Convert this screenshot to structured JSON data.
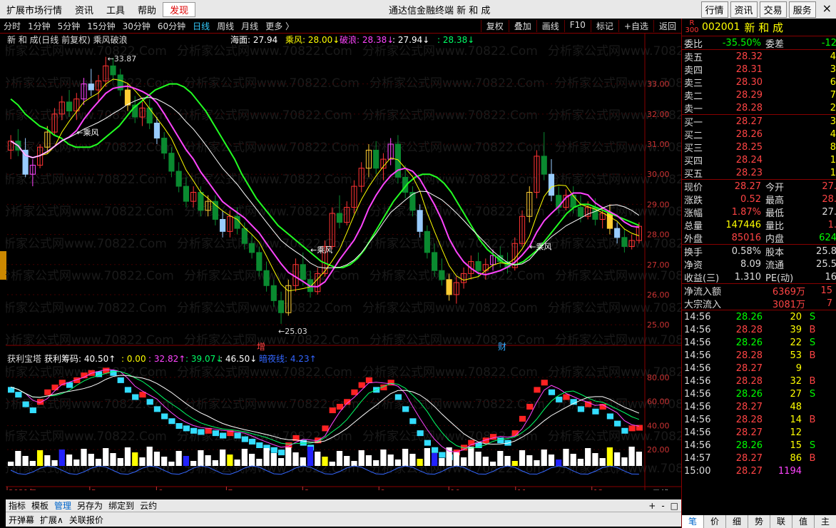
{
  "topbar": {
    "menus": [
      "扩展市场行情",
      "资讯",
      "工具",
      "帮助",
      "发现"
    ],
    "title": "通达信金融终端  新 和 成",
    "right_buttons": [
      "行情",
      "资讯",
      "交易",
      "服务"
    ],
    "close": "×"
  },
  "period": {
    "items": [
      "分时",
      "1分钟",
      "5分钟",
      "15分钟",
      "30分钟",
      "60分钟",
      "日线",
      "周线",
      "月线",
      "更多 〉"
    ],
    "selected": "日线",
    "tools": [
      "复权",
      "叠加",
      "画线",
      "F10",
      "标记",
      "+自选",
      "返回"
    ]
  },
  "main_chart": {
    "title": "新 和 成(日线 前复权) 乘风破浪",
    "legend": [
      {
        "label": "海面: 27.94",
        "color": "#ffffff"
      },
      {
        "label": "乘风: 28.00↓",
        "color": "#ffff00"
      },
      {
        "label": "破浪: 28.38↓",
        "color": "#ff44ff"
      },
      {
        "label": ": 27.94↓",
        "color": "#ffffff"
      },
      {
        "label": ": 28.38↓",
        "color": "#00ff66"
      }
    ],
    "y_ticks": [
      "33.00",
      "32.00",
      "31.00",
      "30.00",
      "29.00",
      "28.00",
      "27.00",
      "26.00",
      "25.00"
    ],
    "high_label": "33.87",
    "low_label": "25.03",
    "signal_label": "乘风",
    "markers": [
      "增",
      "财"
    ]
  },
  "sub_chart": {
    "title": "获利宝塔",
    "legend": [
      {
        "label": "获利筹码: 40.50↑",
        "color": "#ffffff"
      },
      {
        "label": ": 0.00",
        "color": "#ffff00"
      },
      {
        "label": ": 32.82↑",
        "color": "#ff44ff"
      },
      {
        "label": ": 39.07↓",
        "color": "#00ff66"
      },
      {
        "label": ": 46.50↓",
        "color": "#ffffff"
      },
      {
        "label": "暗夜线: 4.23↑",
        "color": "#3366ff"
      }
    ],
    "y_ticks": [
      "80.00",
      "60.00",
      "40.00",
      "20.00"
    ]
  },
  "x_axis": {
    "labels": [
      "2021年",
      "5",
      "6",
      "7",
      "8",
      "9",
      "10",
      "11",
      "12"
    ],
    "period_label": "日线"
  },
  "watermark": "分析家公式网www.70822.Com",
  "bottom_tabs1": [
    "指标",
    "模板",
    "管理",
    "另存为",
    "绑定到",
    "云约"
  ],
  "bottom_tabs1_selected": "管理",
  "bottom_tabs2": [
    "开弹幕",
    "扩展∧",
    "关联报价"
  ],
  "nav_buttons": [
    "+",
    "-",
    "□"
  ],
  "quote": {
    "board": "R",
    "board2": "300",
    "code": "002001",
    "name": "新 和 成",
    "weibi_label": "委比",
    "weibi": "-35.50%",
    "weicha_label": "委差",
    "weicha": "-12",
    "asks": [
      {
        "label": "卖五",
        "price": "28.32",
        "qty": "4"
      },
      {
        "label": "卖四",
        "price": "28.31",
        "qty": "3"
      },
      {
        "label": "卖三",
        "price": "28.30",
        "qty": "6"
      },
      {
        "label": "卖二",
        "price": "28.29",
        "qty": "7"
      },
      {
        "label": "卖一",
        "price": "28.28",
        "qty": "2"
      }
    ],
    "bids": [
      {
        "label": "买一",
        "price": "28.27",
        "qty": "3"
      },
      {
        "label": "买二",
        "price": "28.26",
        "qty": "4"
      },
      {
        "label": "买三",
        "price": "28.25",
        "qty": "8"
      },
      {
        "label": "买四",
        "price": "28.24",
        "qty": "1"
      },
      {
        "label": "买五",
        "price": "28.23",
        "qty": "1"
      }
    ],
    "stats": [
      {
        "k1": "现价",
        "v1": "28.27",
        "c1": "#f44",
        "k2": "今开",
        "v2": "27.",
        "c2": "#f44"
      },
      {
        "k1": "涨跌",
        "v1": "0.52",
        "c1": "#f44",
        "k2": "最高",
        "v2": "28.",
        "c2": "#f44"
      },
      {
        "k1": "涨幅",
        "v1": "1.87%",
        "c1": "#f44",
        "k2": "最低",
        "v2": "27.",
        "c2": "#ddd"
      },
      {
        "k1": "总量",
        "v1": "147446",
        "c1": "#ff0",
        "k2": "量比",
        "v2": "1.",
        "c2": "#f44"
      },
      {
        "k1": "外盘",
        "v1": "85016",
        "c1": "#f44",
        "k2": "内盘",
        "v2": "624",
        "c2": "#0f0"
      }
    ],
    "stats2": [
      {
        "k1": "换手",
        "v1": "0.58%",
        "k2": "股本",
        "v2": "25.8"
      },
      {
        "k1": "净资",
        "v1": "8.09",
        "k2": "流通",
        "v2": "25.5"
      },
      {
        "k1": "收益(三)",
        "v1": "1.310",
        "k2": "PE(动)",
        "v2": "16"
      }
    ],
    "flow": [
      {
        "k": "净流入额",
        "v": "6369万",
        "v2": "15"
      },
      {
        "k": "大宗流入",
        "v": "3081万",
        "v2": "7"
      }
    ],
    "ticks": [
      {
        "t": "14:56",
        "p": "28.26",
        "v": "20",
        "bs": "S"
      },
      {
        "t": "14:56",
        "p": "28.28",
        "v": "39",
        "bs": "B"
      },
      {
        "t": "14:56",
        "p": "28.26",
        "v": "22",
        "bs": "S"
      },
      {
        "t": "14:56",
        "p": "28.28",
        "v": "53",
        "bs": "B"
      },
      {
        "t": "14:56",
        "p": "28.27",
        "v": "9",
        "bs": ""
      },
      {
        "t": "14:56",
        "p": "28.28",
        "v": "32",
        "bs": "B"
      },
      {
        "t": "14:56",
        "p": "28.26",
        "v": "27",
        "bs": "S"
      },
      {
        "t": "14:56",
        "p": "28.27",
        "v": "48",
        "bs": ""
      },
      {
        "t": "14:56",
        "p": "28.28",
        "v": "14",
        "bs": "B"
      },
      {
        "t": "14:56",
        "p": "28.27",
        "v": "12",
        "bs": ""
      },
      {
        "t": "14:56",
        "p": "28.26",
        "v": "15",
        "bs": "S"
      },
      {
        "t": "14:57",
        "p": "28.27",
        "v": "86",
        "bs": "B"
      },
      {
        "t": "15:00",
        "p": "28.27",
        "v": "1194",
        "bs": ""
      }
    ],
    "side_tabs": [
      "笔",
      "价",
      "细",
      "势",
      "联",
      "值",
      "主"
    ]
  },
  "chart_data": {
    "type": "candlestick",
    "title": "新 和 成(日线 前复权) 乘风破浪",
    "ylim": [
      24.6,
      34.2
    ],
    "ma_green": [
      32.5,
      32.3,
      32.0,
      31.8,
      31.6,
      31.5,
      31.3,
      31.2,
      31.0,
      30.9,
      30.9,
      30.9,
      31.0,
      31.2,
      31.4,
      31.6,
      31.9,
      32.2,
      32.4,
      32.6,
      32.8,
      32.9,
      33.0,
      33.0,
      32.9,
      32.7,
      32.4,
      32.1,
      31.7,
      31.3,
      30.9,
      30.5,
      30.0,
      29.6,
      29.2,
      28.9,
      28.6,
      28.3,
      28.1,
      27.9,
      27.7,
      27.5,
      27.3,
      27.1,
      27.0,
      26.9,
      26.9,
      27.0,
      27.2,
      27.5,
      27.9,
      28.3,
      28.7,
      29.1,
      29.4,
      29.7,
      29.9,
      30.0,
      30.0,
      29.9,
      29.7,
      29.4,
      29.0,
      28.6,
      28.2,
      27.8,
      27.5,
      27.3,
      27.1,
      27.0,
      27.0,
      27.1,
      27.3,
      27.5,
      27.8,
      28.1,
      28.4,
      28.7,
      28.9,
      29.0,
      29.0,
      28.9,
      28.8,
      28.7,
      28.6,
      28.5,
      28.4,
      28.3
    ],
    "candles": [
      [
        30.8,
        31.3,
        30.5,
        31.1
      ],
      [
        31.1,
        31.5,
        30.6,
        30.8
      ],
      [
        30.8,
        31.2,
        29.9,
        30.0
      ],
      [
        30.0,
        30.5,
        29.6,
        30.3
      ],
      [
        30.3,
        31.0,
        30.2,
        30.9
      ],
      [
        30.9,
        31.6,
        30.7,
        31.4
      ],
      [
        31.4,
        32.2,
        31.3,
        32.0
      ],
      [
        32.0,
        32.6,
        31.8,
        32.4
      ],
      [
        32.4,
        32.8,
        31.9,
        32.1
      ],
      [
        32.1,
        32.7,
        31.8,
        32.5
      ],
      [
        32.5,
        33.2,
        32.3,
        33.0
      ],
      [
        33.0,
        33.5,
        32.6,
        32.8
      ],
      [
        32.8,
        33.3,
        32.4,
        33.1
      ],
      [
        33.1,
        33.9,
        32.9,
        33.6
      ],
      [
        33.6,
        33.87,
        33.1,
        33.3
      ],
      [
        33.3,
        33.5,
        32.6,
        32.8
      ],
      [
        32.8,
        33.0,
        32.1,
        32.3
      ],
      [
        32.3,
        32.6,
        31.7,
        31.9
      ],
      [
        31.9,
        32.4,
        31.6,
        32.2
      ],
      [
        32.2,
        32.5,
        31.5,
        31.7
      ],
      [
        31.7,
        31.9,
        31.0,
        31.2
      ],
      [
        31.2,
        31.4,
        30.5,
        30.7
      ],
      [
        30.7,
        30.9,
        29.9,
        30.1
      ],
      [
        30.1,
        30.4,
        29.4,
        29.6
      ],
      [
        29.6,
        29.9,
        28.9,
        29.1
      ],
      [
        29.1,
        29.6,
        28.9,
        29.4
      ],
      [
        29.4,
        29.6,
        28.6,
        28.8
      ],
      [
        28.8,
        29.3,
        28.6,
        29.1
      ],
      [
        29.1,
        29.3,
        28.3,
        28.5
      ],
      [
        28.5,
        28.8,
        27.9,
        28.1
      ],
      [
        28.1,
        28.8,
        27.9,
        28.6
      ],
      [
        28.6,
        28.9,
        28.0,
        28.2
      ],
      [
        28.2,
        28.4,
        27.5,
        27.7
      ],
      [
        27.7,
        28.0,
        27.2,
        27.4
      ],
      [
        27.4,
        27.6,
        26.6,
        26.8
      ],
      [
        26.8,
        27.1,
        26.1,
        26.3
      ],
      [
        26.3,
        26.5,
        25.6,
        25.8
      ],
      [
        25.8,
        26.1,
        25.03,
        25.4
      ],
      [
        25.4,
        26.5,
        25.3,
        26.3
      ],
      [
        26.3,
        27.2,
        26.1,
        27.0
      ],
      [
        27.0,
        27.4,
        26.3,
        26.5
      ],
      [
        26.5,
        26.8,
        25.9,
        26.1
      ],
      [
        26.1,
        26.9,
        26.0,
        26.7
      ],
      [
        26.7,
        27.8,
        26.6,
        27.6
      ],
      [
        27.6,
        28.9,
        27.5,
        28.7
      ],
      [
        28.7,
        29.3,
        28.2,
        28.4
      ],
      [
        28.4,
        29.1,
        28.3,
        28.9
      ],
      [
        28.9,
        29.8,
        28.7,
        29.6
      ],
      [
        29.6,
        30.4,
        29.4,
        30.2
      ],
      [
        30.2,
        31.0,
        29.9,
        30.8
      ],
      [
        30.8,
        31.1,
        30.0,
        30.2
      ],
      [
        30.2,
        30.7,
        29.8,
        30.5
      ],
      [
        30.5,
        31.2,
        30.3,
        31.0
      ],
      [
        31.0,
        31.3,
        29.7,
        29.9
      ],
      [
        29.9,
        30.3,
        29.2,
        29.4
      ],
      [
        29.4,
        29.6,
        28.6,
        28.8
      ],
      [
        28.8,
        29.0,
        27.9,
        28.1
      ],
      [
        28.1,
        28.3,
        27.2,
        27.4
      ],
      [
        27.4,
        27.7,
        26.6,
        26.8
      ],
      [
        26.8,
        27.2,
        26.3,
        26.5
      ],
      [
        26.5,
        26.7,
        25.8,
        26.0
      ],
      [
        26.0,
        26.6,
        25.7,
        26.4
      ],
      [
        26.4,
        26.9,
        26.2,
        26.7
      ],
      [
        26.7,
        27.3,
        26.5,
        27.1
      ],
      [
        27.1,
        27.4,
        26.6,
        26.8
      ],
      [
        26.8,
        27.2,
        26.5,
        27.0
      ],
      [
        27.0,
        27.5,
        26.8,
        27.3
      ],
      [
        27.3,
        27.6,
        26.9,
        27.1
      ],
      [
        27.1,
        27.4,
        26.7,
        26.9
      ],
      [
        26.9,
        27.9,
        26.8,
        27.7
      ],
      [
        27.7,
        28.8,
        27.6,
        28.6
      ],
      [
        28.6,
        29.6,
        28.4,
        29.4
      ],
      [
        29.4,
        30.8,
        29.2,
        30.6
      ],
      [
        30.6,
        31.4,
        29.8,
        30.0
      ],
      [
        30.0,
        30.5,
        29.1,
        29.3
      ],
      [
        29.3,
        29.6,
        28.7,
        28.9
      ],
      [
        28.9,
        29.5,
        28.8,
        29.3
      ],
      [
        29.3,
        29.6,
        28.7,
        28.9
      ],
      [
        28.9,
        29.3,
        28.4,
        28.6
      ],
      [
        28.6,
        29.1,
        28.5,
        28.9
      ],
      [
        28.9,
        29.2,
        28.3,
        28.5
      ],
      [
        28.5,
        28.9,
        28.2,
        28.7
      ],
      [
        28.7,
        29.0,
        28.0,
        28.2
      ],
      [
        28.2,
        28.4,
        27.7,
        27.9
      ],
      [
        27.9,
        28.2,
        27.4,
        27.6
      ],
      [
        27.6,
        28.0,
        27.5,
        27.8
      ],
      [
        27.8,
        28.4,
        27.7,
        28.27
      ]
    ],
    "sub_chart": {
      "title": "获利宝塔",
      "ylim": [
        10,
        90
      ],
      "profit": [
        72,
        68,
        60,
        55,
        62,
        70,
        74,
        78,
        76,
        80,
        84,
        86,
        85,
        88,
        86,
        80,
        72,
        66,
        68,
        62,
        56,
        50,
        46,
        42,
        40,
        38,
        37,
        38,
        36,
        34,
        36,
        34,
        31,
        29,
        26,
        24,
        22,
        20,
        26,
        32,
        28,
        24,
        30,
        40,
        55,
        58,
        62,
        70,
        76,
        80,
        72,
        74,
        78,
        66,
        56,
        46,
        36,
        28,
        22,
        18,
        16,
        20,
        24,
        28,
        26,
        30,
        33,
        30,
        28,
        36,
        48,
        58,
        72,
        78,
        70,
        64,
        66,
        62,
        56,
        60,
        54,
        58,
        50,
        44,
        38,
        40,
        40.5
      ],
      "ylabels": [
        "80.00",
        "60.00",
        "40.00",
        "20.00"
      ]
    }
  }
}
